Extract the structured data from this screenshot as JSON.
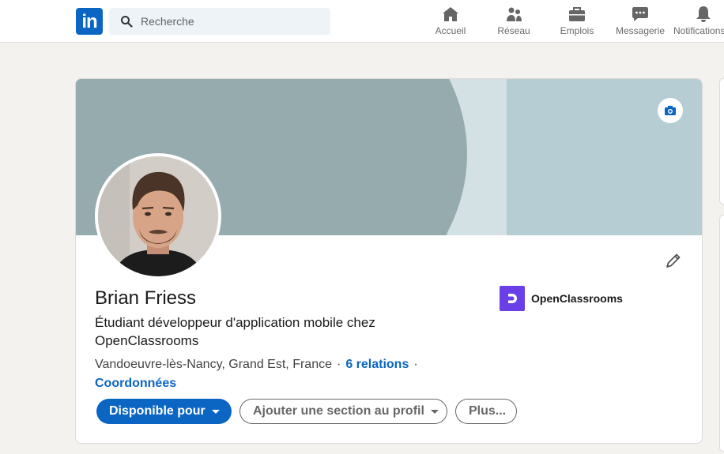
{
  "header": {
    "logo_text": "in",
    "search": {
      "placeholder": "Recherche",
      "value": ""
    },
    "nav": [
      {
        "label": "Accueil",
        "icon": "home-icon"
      },
      {
        "label": "Réseau",
        "icon": "network-icon"
      },
      {
        "label": "Emplois",
        "icon": "briefcase-icon"
      },
      {
        "label": "Messagerie",
        "icon": "messaging-icon"
      },
      {
        "label": "Notifications",
        "icon": "bell-icon"
      }
    ]
  },
  "profile": {
    "name": "Brian Friess",
    "headline": "Étudiant développeur d'application mobile chez OpenClassrooms",
    "location": "Vandoeuvre-lès-Nancy, Grand Est, France",
    "separator": "·",
    "connections": "6 relations",
    "contact_info": "Coordonnées",
    "company": {
      "name": "OpenClassrooms",
      "icon": "openclassrooms-logo-icon",
      "color": "#6a3fe8"
    },
    "banner_icon": "camera-icon",
    "edit_icon": "pencil-icon"
  },
  "actions": {
    "open_to": "Disponible pour",
    "add_section": "Ajouter une section au profil",
    "more": "Plus..."
  },
  "colors": {
    "brand": "#0a66c2",
    "banner_dark": "#95abad",
    "banner_light": "#b6cdd3"
  }
}
